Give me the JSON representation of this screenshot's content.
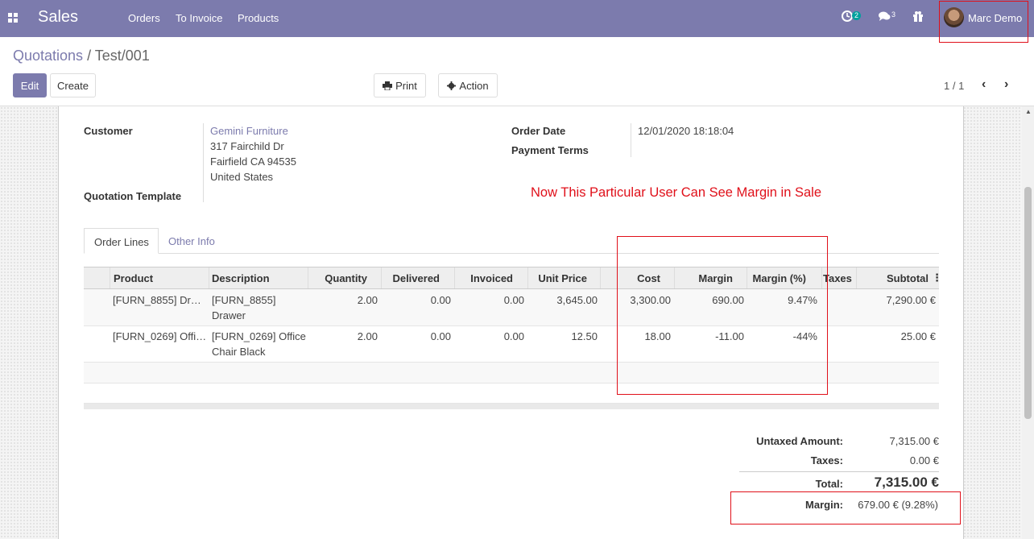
{
  "navbar": {
    "app_name": "Sales",
    "menu": [
      "Orders",
      "To Invoice",
      "Products"
    ],
    "activity_badge": "2",
    "messages_badge": "3",
    "user_name": "Marc Demo",
    "bg_color": "#7c7bad"
  },
  "breadcrumb": {
    "parent": "Quotations",
    "separator": "/",
    "current": "Test/001"
  },
  "buttons": {
    "edit": "Edit",
    "create": "Create",
    "print": "Print",
    "action": "Action"
  },
  "pager": {
    "value": "1 / 1",
    "prev_icon": "chevron-left",
    "next_icon": "chevron-right"
  },
  "form": {
    "customer_label": "Customer",
    "customer_name": "Gemini Furniture",
    "address": [
      "317 Fairchild Dr",
      "Fairfield CA 94535",
      "United States"
    ],
    "template_label": "Quotation Template",
    "order_date_label": "Order Date",
    "order_date": "12/01/2020 18:18:04",
    "payment_terms_label": "Payment Terms"
  },
  "annotation": "Now This Particular User Can See Margin in Sale",
  "tabs": [
    "Order Lines",
    "Other Info"
  ],
  "table": {
    "headers": [
      "Product",
      "Description",
      "Quantity",
      "Delivered",
      "Invoiced",
      "Unit Price",
      "Cost",
      "Margin",
      "Margin (%)",
      "Taxes",
      "Subtotal"
    ],
    "rows": [
      {
        "product": "[FURN_8855] Dr…",
        "description": "[FURN_8855] Drawer",
        "quantity": "2.00",
        "delivered": "0.00",
        "invoiced": "0.00",
        "unit_price": "3,645.00",
        "cost": "3,300.00",
        "margin": "690.00",
        "margin_pct": "9.47%",
        "taxes": "",
        "subtotal": "7,290.00 €"
      },
      {
        "product": "[FURN_0269] Offi…",
        "description": "[FURN_0269] Office Chair Black",
        "quantity": "2.00",
        "delivered": "0.00",
        "invoiced": "0.00",
        "unit_price": "12.50",
        "cost": "18.00",
        "margin": "-11.00",
        "margin_pct": "-44%",
        "taxes": "",
        "subtotal": "25.00 €"
      }
    ]
  },
  "totals": {
    "untaxed_label": "Untaxed Amount:",
    "untaxed": "7,315.00 €",
    "taxes_label": "Taxes:",
    "taxes": "0.00 €",
    "total_label": "Total:",
    "total": "7,315.00 €",
    "margin_label": "Margin:",
    "margin": "679.00 € (9.28%)"
  },
  "highlight_color": "#e0101a"
}
